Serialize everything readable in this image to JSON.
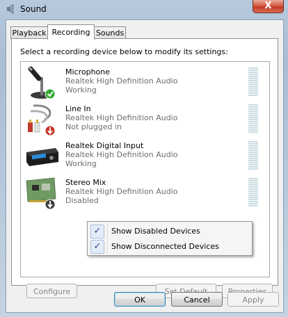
{
  "window": {
    "title": "Sound",
    "close_label": "X"
  },
  "tabs": [
    {
      "label": "Playback"
    },
    {
      "label": "Recording"
    },
    {
      "label": "Sounds"
    }
  ],
  "instruction": "Select a recording device below to modify its settings:",
  "devices": [
    {
      "name": "Microphone",
      "driver": "Realtek High Definition Audio",
      "status": "Working",
      "icon": "microphone-icon",
      "badge": "green-check"
    },
    {
      "name": "Line In",
      "driver": "Realtek High Definition Audio",
      "status": "Not plugged in",
      "icon": "audio-cable-icon",
      "badge": "red-down-arrow"
    },
    {
      "name": "Realtek Digital Input",
      "driver": "Realtek High Definition Audio",
      "status": "Working",
      "icon": "digital-input-device-icon",
      "badge": "none"
    },
    {
      "name": "Stereo Mix",
      "driver": "Realtek High Definition Audio",
      "status": "Disabled",
      "icon": "sound-card-icon",
      "badge": "gray-down-arrow"
    }
  ],
  "context_menu": {
    "items": [
      {
        "label": "Show Disabled Devices",
        "checked": true
      },
      {
        "label": "Show Disconnected Devices",
        "checked": true
      }
    ]
  },
  "panel_buttons": {
    "configure": "Configure",
    "set_default": "Set Default",
    "properties": "Properties"
  },
  "dialog_buttons": {
    "ok": "OK",
    "cancel": "Cancel",
    "apply": "Apply"
  },
  "colors": {
    "selection_check": "#1f3f8a",
    "status_gray": "#6d6d6d",
    "close_red": "#c0392b"
  }
}
